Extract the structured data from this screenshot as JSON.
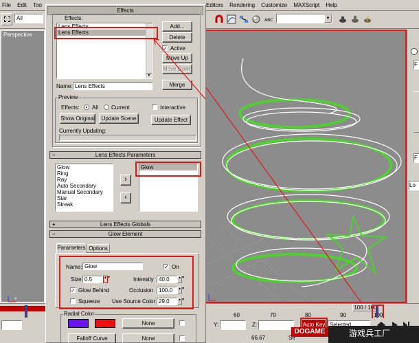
{
  "menubar": {
    "left_items": [
      "File",
      "Edit",
      "Too"
    ],
    "right_items": [
      "Editors",
      "Rendering",
      "Customize",
      "MAXScript",
      "Help"
    ]
  },
  "toolbar": {
    "selection_filter": "All"
  },
  "viewport": {
    "label": "Perspective",
    "frame_counter": "100 / 100",
    "ruler_ticks": [
      "60",
      "70",
      "80",
      "90",
      "100"
    ],
    "coord_y_label": "Y:",
    "coord_z_label": "Z:",
    "coord_value": "66.67"
  },
  "right_panel": {
    "lo_label": "Lo",
    "f_label": "F"
  },
  "statusbar": {
    "auto_key": "Auto Key",
    "selected": "Selected",
    "set_key_partial": "Se"
  },
  "effects_window": {
    "title": "Effects",
    "effects_label": "Effects:",
    "effects_list": [
      "Lens Effects",
      "Lens Effects"
    ],
    "selected_index": 1,
    "buttons": {
      "add": "Add...",
      "delete": "Delete",
      "active": "Active",
      "move_up": "Move Up",
      "move_down": "Move Down",
      "merge": "Merge"
    },
    "active_checked": true,
    "name_label": "Name:",
    "name_value": "Lens Effects",
    "preview": {
      "title": "Preview",
      "effects_label": "Effects:",
      "all_label": "All",
      "current_label": "Current",
      "all_selected": true,
      "interactive_label": "Interactive",
      "interactive_checked": false,
      "show_original": "Show Original",
      "update_scene": "Update Scene",
      "update_effect": "Update Effect",
      "currently_updating": "Currently Updating:"
    },
    "lens_params": {
      "title": "Lens Effects Parameters",
      "available": [
        "Glow",
        "Ring",
        "Ray",
        "Auto Secondary",
        "Manual Secondary",
        "Star",
        "Streak"
      ],
      "active": [
        "Glow"
      ],
      "arrow_right": "›",
      "arrow_left": "‹"
    },
    "lens_globals_title": "Lens Effects Globals",
    "glow_element": {
      "title": "Glow Element",
      "tabs": [
        "Parameters",
        "Options"
      ],
      "name_label": "Name:",
      "name_value": "Glow",
      "on_label": "On",
      "on_checked": true,
      "size_label": "Size",
      "size_value": "0.5",
      "intensity_label": "Intensity",
      "intensity_value": "40.0",
      "glow_behind_label": "Glow Behind",
      "glow_behind_checked": true,
      "occlusion_label": "Occlusion",
      "occlusion_value": "100.0",
      "squeeze_label": "Squeeze",
      "squeeze_checked": false,
      "use_source_color_label": "Use Source Color",
      "use_source_color_value": "29.0",
      "radial_color_label": "Radial Color",
      "color1": "#6a12f0",
      "color2": "#f01010",
      "none_label": "None",
      "falloff_curve": "Falloff Curve"
    }
  },
  "watermark": {
    "brand": "DOGAME",
    "chinese": "游戏兵工厂"
  },
  "colors": {
    "highlight_red": "#e01818",
    "window_title_blue": "#0a246a",
    "wire_green": "#50d030",
    "viewport_gray": "#8c8c8c"
  }
}
